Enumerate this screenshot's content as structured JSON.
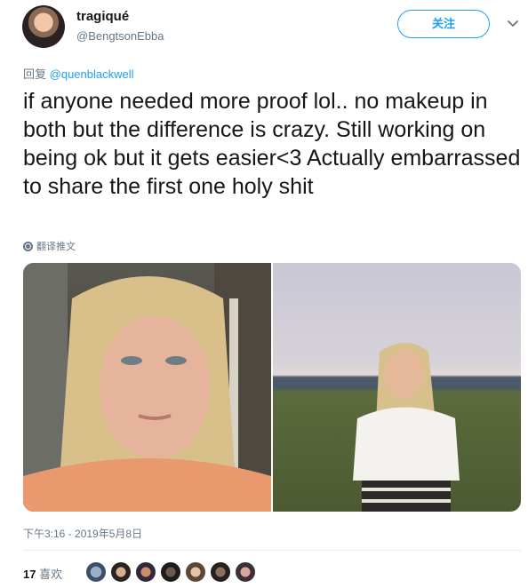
{
  "author": {
    "display_name": "tragiqué",
    "handle": "@BengtsonEbba",
    "follow_label": "关注"
  },
  "reply": {
    "prefix": "回复",
    "mention": "@quenblackwell"
  },
  "tweet": {
    "text": "if anyone needed more proof lol.. no makeup in both but the difference is crazy. Still working on being ok but it gets easier<3 Actually embarrassed to share the first one holy shit",
    "translate_label": "翻译推文",
    "timestamp": "下午3:16 - 2019年5月8日",
    "likes_count": "17",
    "likes_label": "喜欢"
  },
  "colors": {
    "accent": "#1da1f2",
    "muted": "#657786",
    "text": "#14171a",
    "divider": "#e6ecf0"
  },
  "icons": {
    "more": "chevron-down-icon",
    "translate": "globe-icon"
  }
}
